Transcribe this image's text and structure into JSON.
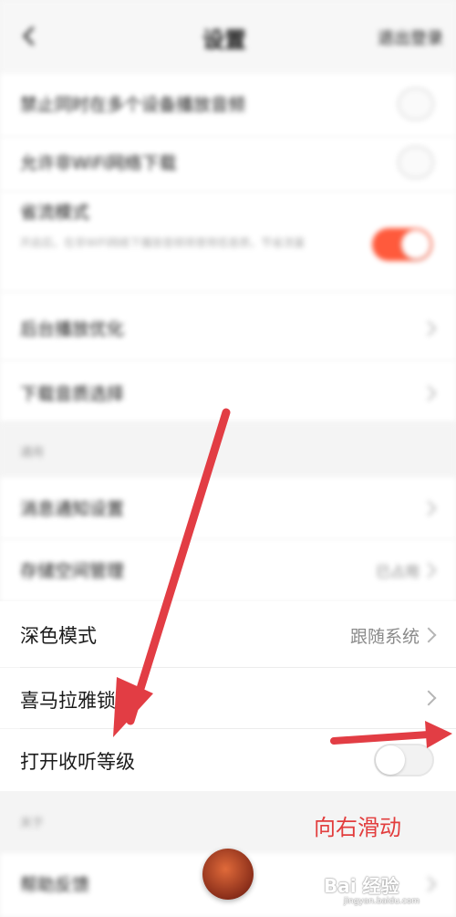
{
  "header": {
    "title": "设置",
    "right_action": "退出登录"
  },
  "top_rows": [
    "禁止同时在多个设备播放音频",
    "允许非WiFi网络下载",
    "省流模式",
    "后台播放优化",
    "下载音质选择"
  ],
  "saver_desc": "开启后，在非WiFi网络下播放音频将使用低音质，节省流量",
  "section1_title": "通用",
  "mid_rows": [
    "消息通知设置",
    "存储空间管理"
  ],
  "storage_value": "已占用",
  "dark_mode": {
    "label": "深色模式",
    "value": "跟随系统"
  },
  "lock_screen": {
    "label": "喜马拉雅锁屏"
  },
  "listen_level": {
    "label": "打开收听等级",
    "enabled": false
  },
  "section2_title": "关于",
  "bottom_row": "帮助反馈",
  "annotation": {
    "text": "向右滑动",
    "color": "#e23d3d"
  },
  "colors": {
    "accent": "#ff5a3c",
    "arrow": "#e23d44",
    "background": "#f4f4f4"
  },
  "watermark": {
    "text": "Bai 经验",
    "sub": "jingyan.baidu.com"
  }
}
